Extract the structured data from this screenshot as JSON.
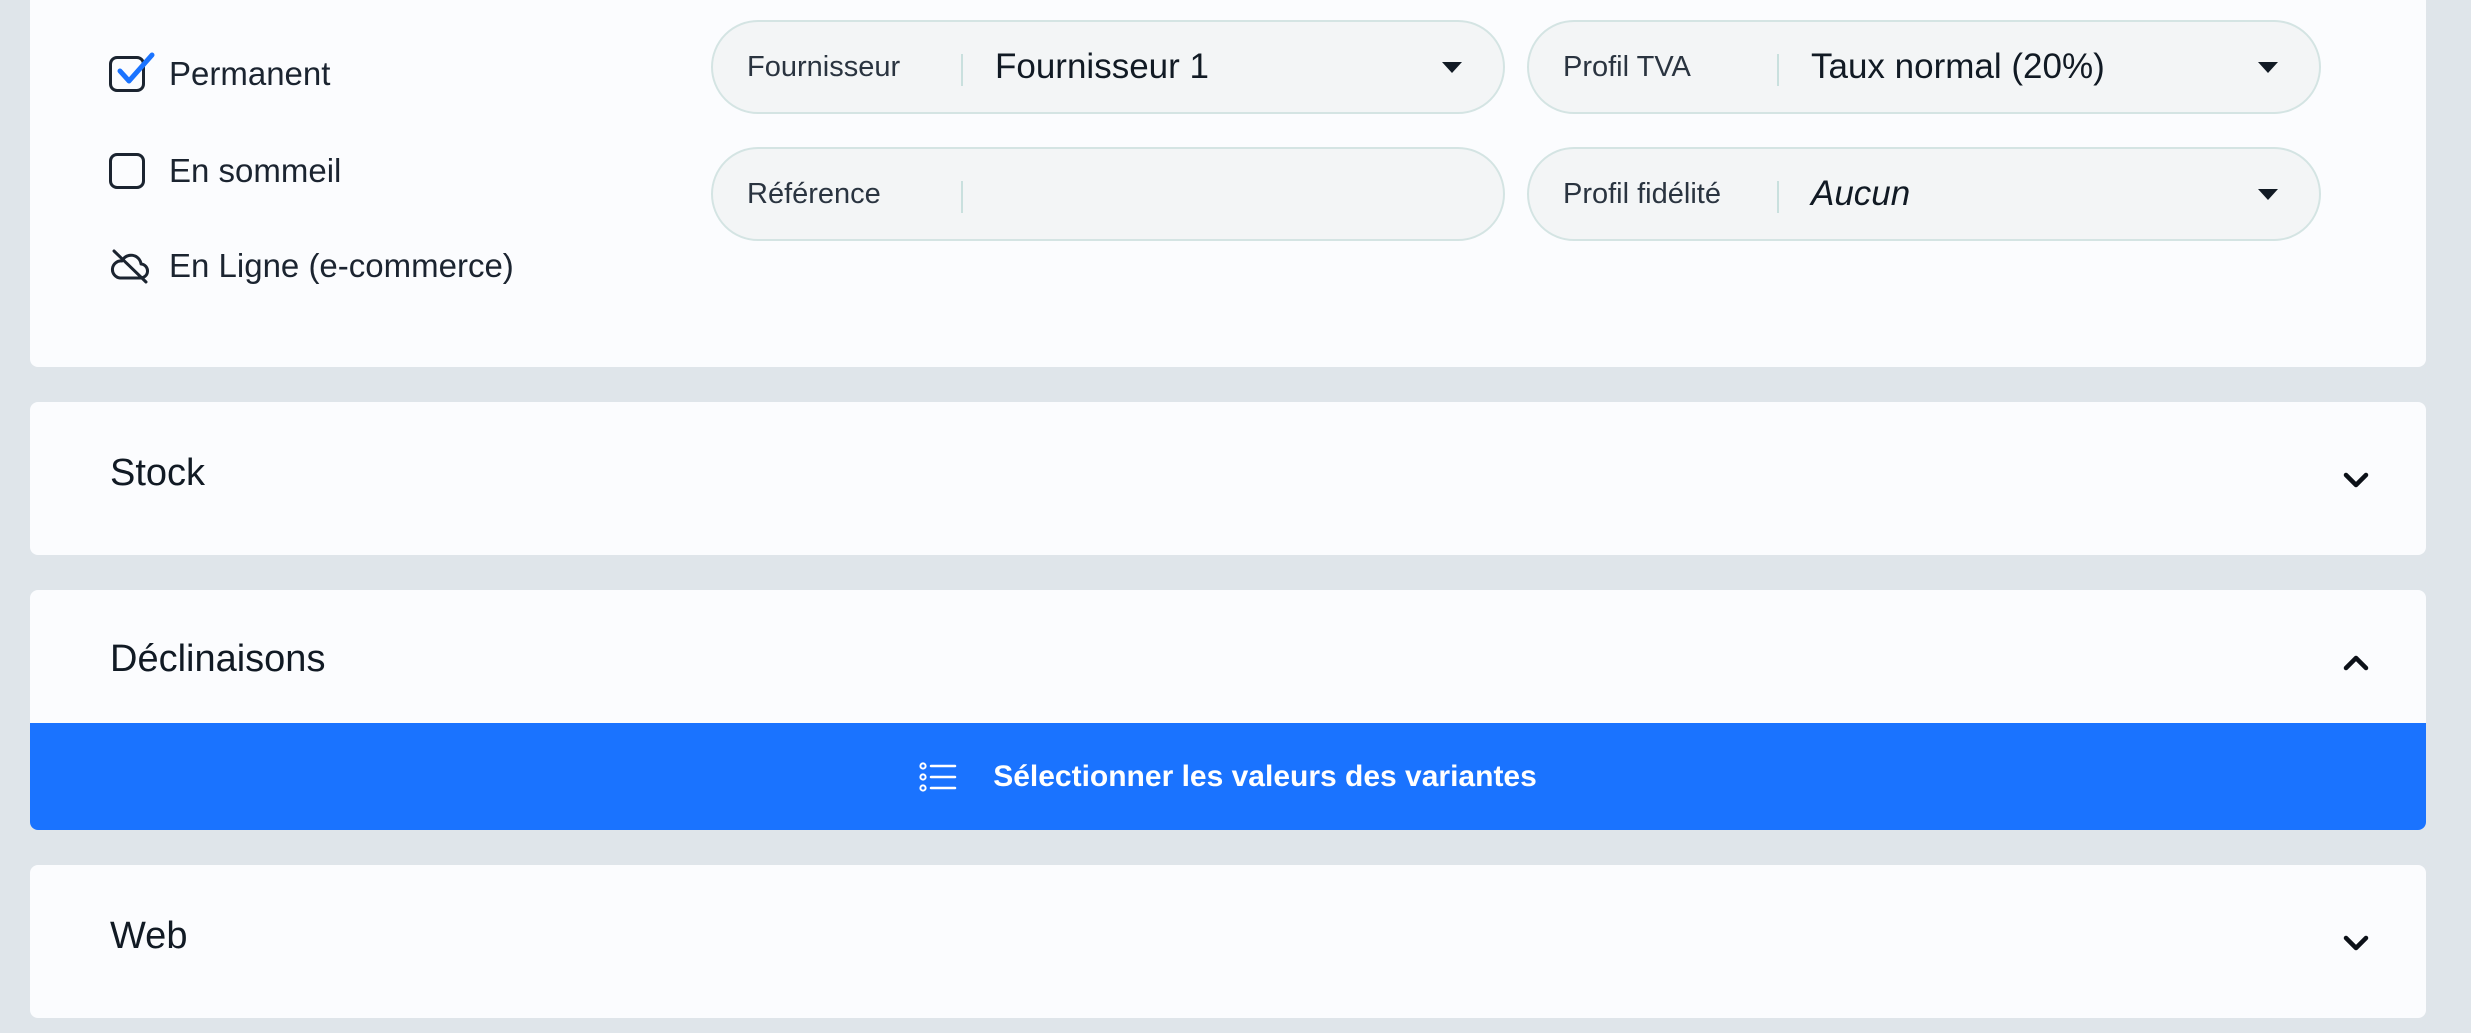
{
  "options": {
    "permanent": {
      "label": "Permanent",
      "checked": true
    },
    "sleeping": {
      "label": "En sommeil",
      "checked": false
    },
    "online": {
      "label": "En Ligne (e-commerce)"
    }
  },
  "fields": {
    "supplier": {
      "label": "Fournisseur",
      "value": "Fournisseur 1"
    },
    "vat_profile": {
      "label": "Profil TVA",
      "value": "Taux normal (20%)"
    },
    "reference": {
      "label": "Référence",
      "value": ""
    },
    "loyalty_profile": {
      "label": "Profil fidélité",
      "value": "Aucun"
    }
  },
  "sections": {
    "stock": {
      "title": "Stock",
      "expanded": false
    },
    "declinations": {
      "title": "Déclinaisons",
      "expanded": true,
      "select_button_label": "Sélectionner les valeurs des variantes"
    },
    "web": {
      "title": "Web",
      "expanded": false
    }
  },
  "icons": {
    "check": "check-icon",
    "cloud_off": "cloud-off-icon",
    "caret": "caret-down-icon",
    "chevron_down": "chevron-down-icon",
    "chevron_up": "chevron-up-icon",
    "list": "list-icon"
  },
  "colors": {
    "accent": "#1a73ff",
    "page_background": "#dfe5ea",
    "card_background": "#fbfcfe",
    "field_border": "#d4e4e3"
  }
}
